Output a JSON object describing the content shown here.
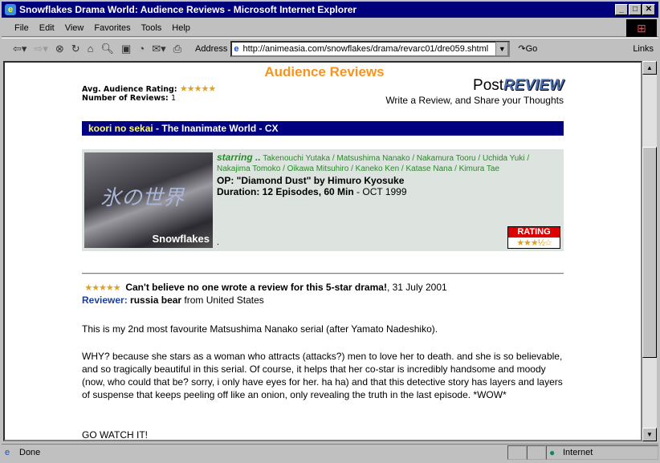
{
  "window": {
    "title": "Snowflakes Drama World: Audience Reviews - Microsoft Internet Explorer"
  },
  "menu": [
    "File",
    "Edit",
    "View",
    "Favorites",
    "Tools",
    "Help"
  ],
  "toolbar": {
    "address_label": "Address",
    "url": "http://animeasia.com/snowflakes/drama/revarc01/dre059.shtml",
    "go_label": "Go",
    "links_label": "Links"
  },
  "page": {
    "heading": "Audience Reviews",
    "avg_label": "Avg. Audience Rating:",
    "avg_stars": "★★★★★",
    "num_label": "Number of Reviews:",
    "num_value": "1",
    "post": "Post",
    "review": "REVIEW",
    "tagline": "Write a Review, and Share your Thoughts",
    "banner_jp": "koori no sekai",
    "banner_rest": " - The Inanimate World - CX",
    "thumb_kanji": "氷の世界",
    "thumb_brand": "Snowflakes",
    "starring_label": "starring ..",
    "cast": " Takenouchi Yutaka / Matsushima Nanako / Nakamura Tooru / Uchida Yuki / Nakajima Tomoko / Oikawa Mitsuhiro / Kaneko Ken / Katase Nana / Kimura Tae",
    "op": "OP: \"Diamond Dust\" by Himuro Kyosuke",
    "duration": "Duration: 12 Episodes, 60 Min",
    "date": " - OCT 1999",
    "rating_label": "RATING",
    "rating_stars": "★★★½☆",
    "rating_value": 3.5
  },
  "review": {
    "stars": "★★★★★",
    "title": "Can't believe no one wrote a review for this 5-star drama!",
    "date": ", 31 July 2001",
    "reviewer_label": "Reviewer:",
    "reviewer": "russia bear",
    "from": " from United States",
    "p1": "This is my 2nd most favourite Matsushima Nanako serial (after Yamato Nadeshiko).",
    "p2": "WHY? because she stars as a woman who attracts (attacks?) men to love her to death. and she is so believable, and so tragically beautiful in this serial. Of course, it helps that her co-star is incredibly handsome and moody (now, who could that be? sorry, i only have eyes for her. ha ha) and that this detective story has layers and layers of suspense that keeps peeling off like an onion, only revealing the truth in the last episode. *WOW*",
    "p3": "GO WATCH IT!"
  },
  "status": {
    "text": "Done",
    "zone": "Internet"
  }
}
